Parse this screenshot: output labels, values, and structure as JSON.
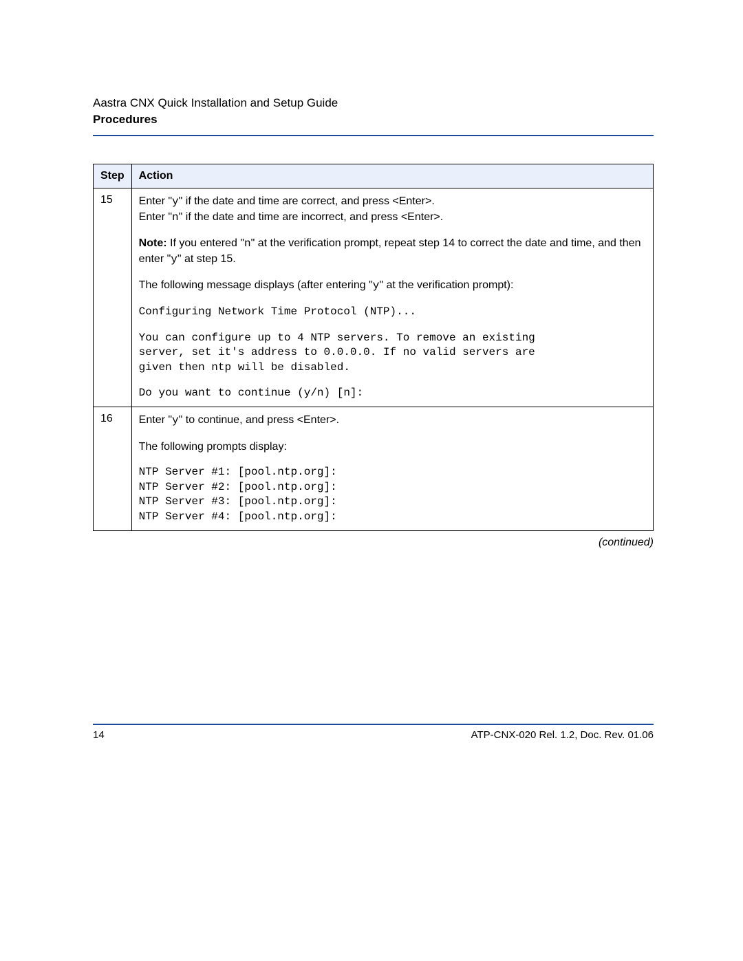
{
  "header": {
    "doc_title": "Aastra CNX Quick Installation and Setup Guide",
    "section_title": "Procedures"
  },
  "table": {
    "headers": {
      "step": "Step",
      "action": "Action"
    },
    "rows": [
      {
        "step": "15",
        "line1_a": "Enter \"",
        "line1_b": "y",
        "line1_c": "\" if the date and time are correct, and press <Enter>.",
        "line2_a": "Enter \"",
        "line2_b": "n",
        "line2_c": "\" if the date and time are incorrect, and press <Enter>.",
        "note_label": "Note:",
        "note_a": " If you entered \"",
        "note_b": "n",
        "note_c": "\" at the verification prompt, repeat step 14 to correct the date and time, and then enter \"",
        "note_d": "y",
        "note_e": "\" at step 15.",
        "msg_a": "The following message displays (after entering \"",
        "msg_b": "y",
        "msg_c": "\" at the verification prompt):",
        "code1": "Configuring Network Time Protocol (NTP)...",
        "code2": "You can configure up to 4 NTP servers. To remove an existing\nserver, set it's address to 0.0.0.0. If no valid servers are\ngiven then ntp will be disabled.",
        "code3": "Do you want to continue (y/n) [n]:"
      },
      {
        "step": "16",
        "line1_a": "Enter \"",
        "line1_b": "y",
        "line1_c": "\" to continue, and press <Enter>.",
        "prompts_intro": "The following prompts display:",
        "code": "NTP Server #1: [pool.ntp.org]:\nNTP Server #2: [pool.ntp.org]:\nNTP Server #3: [pool.ntp.org]:\nNTP Server #4: [pool.ntp.org]:"
      }
    ]
  },
  "continued": "(continued)",
  "footer": {
    "page_number": "14",
    "doc_ref": "ATP-CNX-020 Rel. 1.2, Doc. Rev. 01.06"
  }
}
